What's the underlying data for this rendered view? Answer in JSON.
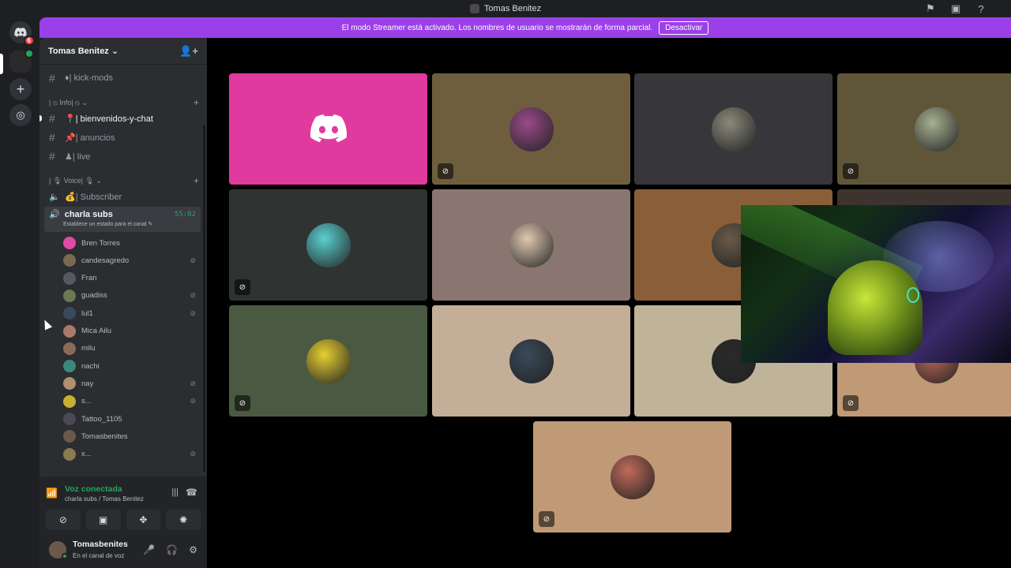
{
  "window": {
    "title": "Tomas Benitez"
  },
  "banner": {
    "text": "El modo Streamer está activado. Los nombres de usuario se mostrarán de forma parcial.",
    "button": "Desactivar"
  },
  "servers": {
    "home_badge": "6"
  },
  "guild": {
    "name": "Tomas Benitez ⌄"
  },
  "channels": {
    "kick_mods": "♦| kick-mods",
    "info_category": "| ⦸ Info| ⦸ ⌄",
    "bienvenidos": "📍| bienvenidos-y-chat",
    "anuncios": "📌| anuncios",
    "live": "♟| live",
    "voice_category": "| 🎙 Voice| 🎙 ⌄",
    "subscriber": "💰| Subscriber",
    "charla_subs": "charla subs",
    "charla_timer": "55:02",
    "charla_status": "Establece un estado para el canal ✎"
  },
  "members": [
    {
      "name": "Bren Torres",
      "muted": false,
      "color": "#e14aa5"
    },
    {
      "name": "candesagredo",
      "muted": true,
      "color": "#7a6a50"
    },
    {
      "name": "Fran",
      "muted": false,
      "color": "#555a60"
    },
    {
      "name": "guadiss",
      "muted": true,
      "color": "#6a7a50"
    },
    {
      "name": "lul1",
      "muted": true,
      "color": "#3a4a5a"
    },
    {
      "name": "Mica Ailu",
      "muted": false,
      "color": "#a87a6a"
    },
    {
      "name": "milu",
      "muted": false,
      "color": "#8a6a5a"
    },
    {
      "name": "nachi",
      "muted": false,
      "color": "#3a8a7a"
    },
    {
      "name": "nay",
      "muted": true,
      "color": "#b09070"
    },
    {
      "name": "s...",
      "muted": true,
      "color": "#c8b030"
    },
    {
      "name": "Tattoo_1105",
      "muted": false,
      "color": "#4a4a55"
    },
    {
      "name": "Tomasbenites",
      "muted": false,
      "color": "#6b5a4a"
    },
    {
      "name": "x...",
      "muted": true,
      "color": "#8a7a50"
    }
  ],
  "voice_panel": {
    "status": "Voz conectada",
    "location": "charla subs / Tomas Benitez"
  },
  "user_panel": {
    "username": "Tomasbenites",
    "status": "En el canal de voz"
  },
  "tiles": [
    {
      "bg": "#e03a9e",
      "muted": false,
      "avatar": "discord-logo"
    },
    {
      "bg": "#6e5e3e",
      "muted": true,
      "avatar": "#9a4a8a"
    },
    {
      "bg": "#37363a",
      "muted": false,
      "avatar": "#8a8a7a"
    },
    {
      "bg": "#5f5639",
      "muted": true,
      "avatar": "#a8b090"
    },
    {
      "bg": "#2f3432",
      "muted": true,
      "avatar": "#5ad0d0"
    },
    {
      "bg": "#8a7670",
      "muted": false,
      "avatar": "#e0c8b0"
    },
    {
      "bg": "#8a5e38",
      "muted": false,
      "avatar": "#6a5a4a"
    },
    {
      "bg": "#3e342f",
      "muted": true,
      "avatar": "#d8c8c0"
    },
    {
      "bg": "#4a5a42",
      "muted": true,
      "avatar": "#e8d030"
    },
    {
      "bg": "#c4ae98",
      "muted": false,
      "avatar": "#3a4a5a"
    },
    {
      "bg": "#bfb39a",
      "muted": false,
      "avatar": "#2a2a2a"
    },
    {
      "bg": "#c09a76",
      "muted": true,
      "avatar": "#c06a5a"
    }
  ],
  "colors": {
    "accent_green": "#23a55a",
    "banner_purple": "#9b40e8",
    "sidebar_bg": "#2b2d31"
  }
}
